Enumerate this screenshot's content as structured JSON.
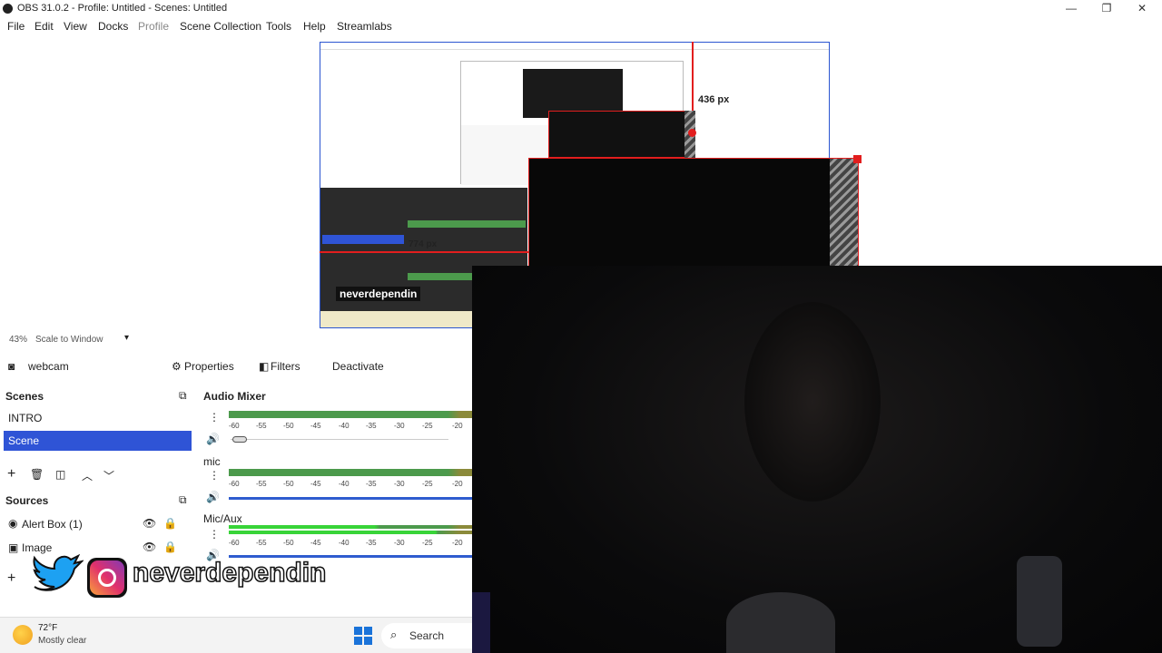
{
  "window": {
    "title": "OBS 31.0.2 - Profile: Untitled - Scenes: Untitled",
    "minimize": "—",
    "maximize": "❐",
    "close": "✕"
  },
  "menu": {
    "items": [
      "File",
      "Edit",
      "View",
      "Docks",
      "Profile",
      "Scene Collection",
      "Tools",
      "Help",
      "Streamlabs"
    ]
  },
  "preview": {
    "measure_top": "436 px",
    "measure_left": "774 px",
    "zoom": "43%",
    "scale_mode": "Scale to Window",
    "overlay_text": "neverdependin"
  },
  "source_toolbar": {
    "source_name": "webcam",
    "properties": "Properties",
    "filters": "Filters",
    "deactivate": "Deactivate"
  },
  "scenes": {
    "title": "Scenes",
    "items": [
      "INTRO",
      "Scene"
    ],
    "selected": "Scene"
  },
  "sources": {
    "title": "Sources",
    "items": [
      "Alert Box (1)",
      "Image"
    ]
  },
  "audio_mixer": {
    "title": "Audio Mixer",
    "channels": [
      {
        "name": "",
        "level": 0.02
      },
      {
        "name": "mic",
        "level": 1.0
      },
      {
        "name": "Mic/Aux",
        "level": 1.0
      }
    ],
    "scale_labels": [
      "-60",
      "-55",
      "-50",
      "-45",
      "-40",
      "-35",
      "-30",
      "-25",
      "-20"
    ]
  },
  "taskbar": {
    "weather_temp": "72°F",
    "weather_desc": "Mostly clear",
    "search": "Search"
  },
  "colors": {
    "accent_blue": "#2f54d6",
    "meter_green": "#4c9a4c",
    "measure_red": "#e21e1e"
  }
}
